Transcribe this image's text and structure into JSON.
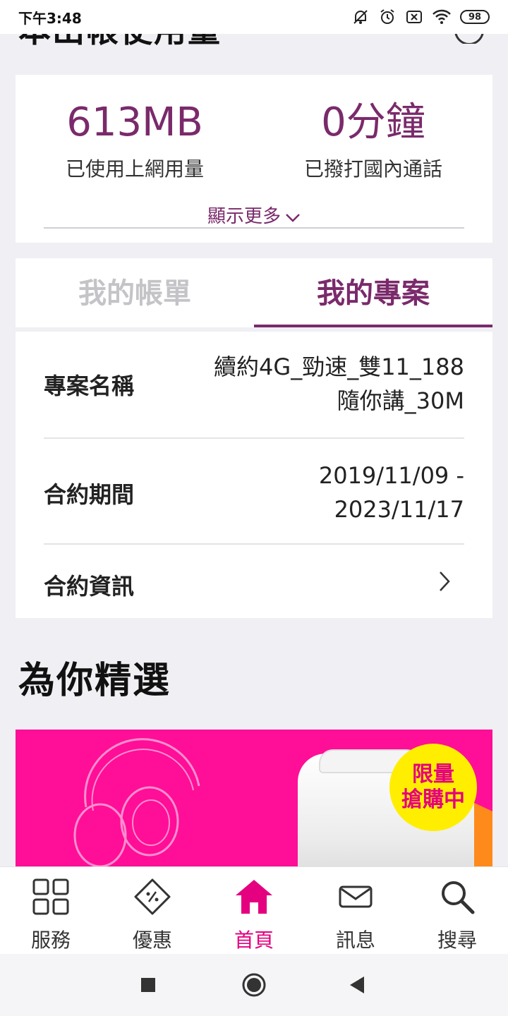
{
  "status_bar": {
    "time": "下午3:48",
    "battery": "98",
    "icons": [
      "bell-muted-icon",
      "alarm-icon",
      "sim-off-icon",
      "wifi-icon",
      "battery-icon"
    ]
  },
  "colors": {
    "accent_purple": "#7a2a6b",
    "accent_pink": "#e4007f",
    "banner_pink": "#ff0e97",
    "badge_yellow": "#ffee00",
    "background": "#efeff4"
  },
  "header": {
    "heading_partial": "本出帳使用量"
  },
  "usage": {
    "data_value": "613MB",
    "data_label": "已使用上網用量",
    "call_value": "0分鐘",
    "call_label": "已撥打國內通話",
    "show_more": "顯示更多"
  },
  "tabs": {
    "bill": "我的帳單",
    "plan": "我的專案",
    "active": "plan"
  },
  "plan": {
    "name_label": "專案名稱",
    "name_value_line1": "續約4G_勁速_雙11_188",
    "name_value_line2": "隨你講_30M",
    "period_label": "合約期間",
    "period_start": "2019/11/09 -",
    "period_end": "2023/11/17",
    "contract_info_label": "合約資訊"
  },
  "featured": {
    "title": "為你精選",
    "badge_line1": "限量",
    "badge_line2": "搶購中"
  },
  "bottom_nav": {
    "items": [
      {
        "label": "服務",
        "icon": "grid-icon"
      },
      {
        "label": "優惠",
        "icon": "coupon-icon"
      },
      {
        "label": "首頁",
        "icon": "home-icon"
      },
      {
        "label": "訊息",
        "icon": "mail-icon"
      },
      {
        "label": "搜尋",
        "icon": "search-icon"
      }
    ],
    "active": "首頁"
  }
}
